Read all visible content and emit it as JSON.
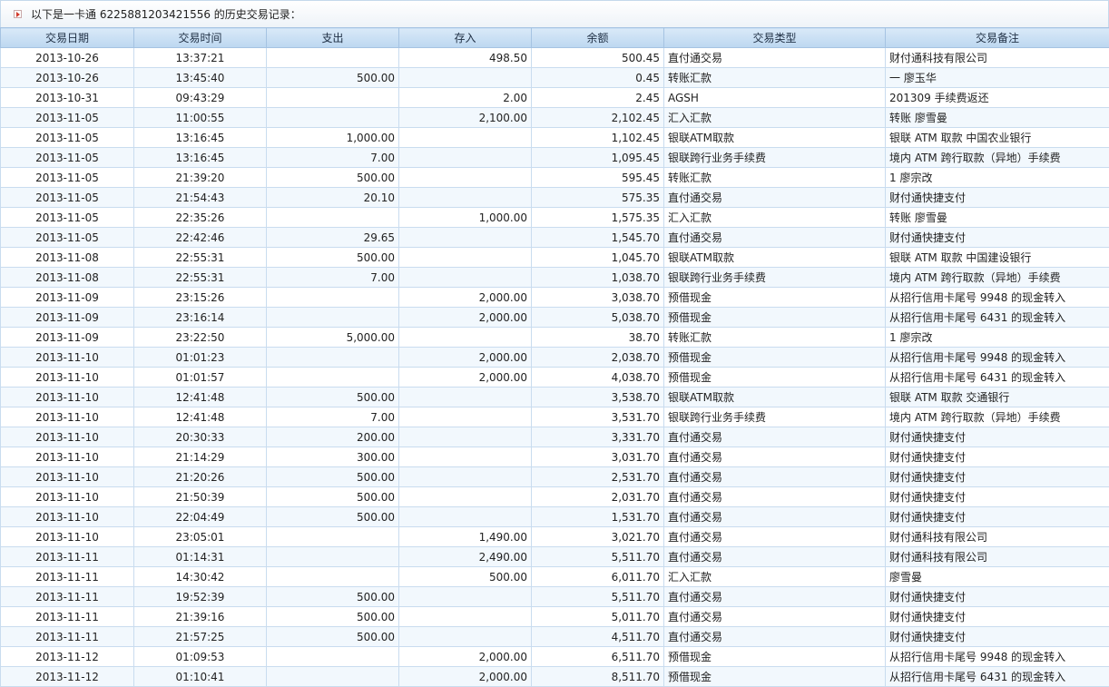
{
  "title": "以下是一卡通 6225881203421556 的历史交易记录：",
  "columns": [
    "交易日期",
    "交易时间",
    "支出",
    "存入",
    "余额",
    "交易类型",
    "交易备注"
  ],
  "rows": [
    [
      "2013-10-26",
      "13:37:21",
      "",
      "498.50",
      "500.45",
      "直付通交易",
      "财付通科技有限公司"
    ],
    [
      "2013-10-26",
      "13:45:40",
      "500.00",
      "",
      "0.45",
      "转账汇款",
      "一 廖玉华"
    ],
    [
      "2013-10-31",
      "09:43:29",
      "",
      "2.00",
      "2.45",
      "AGSH",
      "201309 手续费返还"
    ],
    [
      "2013-11-05",
      "11:00:55",
      "",
      "2,100.00",
      "2,102.45",
      "汇入汇款",
      "转账 廖雪曼"
    ],
    [
      "2013-11-05",
      "13:16:45",
      "1,000.00",
      "",
      "1,102.45",
      "银联ATM取款",
      "银联 ATM 取款 中国农业银行"
    ],
    [
      "2013-11-05",
      "13:16:45",
      "7.00",
      "",
      "1,095.45",
      "银联跨行业务手续费",
      "境内 ATM 跨行取款（异地）手续费"
    ],
    [
      "2013-11-05",
      "21:39:20",
      "500.00",
      "",
      "595.45",
      "转账汇款",
      "1 廖宗改"
    ],
    [
      "2013-11-05",
      "21:54:43",
      "20.10",
      "",
      "575.35",
      "直付通交易",
      "财付通快捷支付"
    ],
    [
      "2013-11-05",
      "22:35:26",
      "",
      "1,000.00",
      "1,575.35",
      "汇入汇款",
      "转账 廖雪曼"
    ],
    [
      "2013-11-05",
      "22:42:46",
      "29.65",
      "",
      "1,545.70",
      "直付通交易",
      "财付通快捷支付"
    ],
    [
      "2013-11-08",
      "22:55:31",
      "500.00",
      "",
      "1,045.70",
      "银联ATM取款",
      "银联 ATM 取款 中国建设银行"
    ],
    [
      "2013-11-08",
      "22:55:31",
      "7.00",
      "",
      "1,038.70",
      "银联跨行业务手续费",
      "境内 ATM 跨行取款（异地）手续费"
    ],
    [
      "2013-11-09",
      "23:15:26",
      "",
      "2,000.00",
      "3,038.70",
      "预借现金",
      "从招行信用卡尾号 9948 的现金转入"
    ],
    [
      "2013-11-09",
      "23:16:14",
      "",
      "2,000.00",
      "5,038.70",
      "预借现金",
      "从招行信用卡尾号 6431 的现金转入"
    ],
    [
      "2013-11-09",
      "23:22:50",
      "5,000.00",
      "",
      "38.70",
      "转账汇款",
      "1 廖宗改"
    ],
    [
      "2013-11-10",
      "01:01:23",
      "",
      "2,000.00",
      "2,038.70",
      "预借现金",
      "从招行信用卡尾号 9948 的现金转入"
    ],
    [
      "2013-11-10",
      "01:01:57",
      "",
      "2,000.00",
      "4,038.70",
      "预借现金",
      "从招行信用卡尾号 6431 的现金转入"
    ],
    [
      "2013-11-10",
      "12:41:48",
      "500.00",
      "",
      "3,538.70",
      "银联ATM取款",
      "银联 ATM 取款 交通银行"
    ],
    [
      "2013-11-10",
      "12:41:48",
      "7.00",
      "",
      "3,531.70",
      "银联跨行业务手续费",
      "境内 ATM 跨行取款（异地）手续费"
    ],
    [
      "2013-11-10",
      "20:30:33",
      "200.00",
      "",
      "3,331.70",
      "直付通交易",
      "财付通快捷支付"
    ],
    [
      "2013-11-10",
      "21:14:29",
      "300.00",
      "",
      "3,031.70",
      "直付通交易",
      "财付通快捷支付"
    ],
    [
      "2013-11-10",
      "21:20:26",
      "500.00",
      "",
      "2,531.70",
      "直付通交易",
      "财付通快捷支付"
    ],
    [
      "2013-11-10",
      "21:50:39",
      "500.00",
      "",
      "2,031.70",
      "直付通交易",
      "财付通快捷支付"
    ],
    [
      "2013-11-10",
      "22:04:49",
      "500.00",
      "",
      "1,531.70",
      "直付通交易",
      "财付通快捷支付"
    ],
    [
      "2013-11-10",
      "23:05:01",
      "",
      "1,490.00",
      "3,021.70",
      "直付通交易",
      "财付通科技有限公司"
    ],
    [
      "2013-11-11",
      "01:14:31",
      "",
      "2,490.00",
      "5,511.70",
      "直付通交易",
      "财付通科技有限公司"
    ],
    [
      "2013-11-11",
      "14:30:42",
      "",
      "500.00",
      "6,011.70",
      "汇入汇款",
      "廖雪曼"
    ],
    [
      "2013-11-11",
      "19:52:39",
      "500.00",
      "",
      "5,511.70",
      "直付通交易",
      "财付通快捷支付"
    ],
    [
      "2013-11-11",
      "21:39:16",
      "500.00",
      "",
      "5,011.70",
      "直付通交易",
      "财付通快捷支付"
    ],
    [
      "2013-11-11",
      "21:57:25",
      "500.00",
      "",
      "4,511.70",
      "直付通交易",
      "财付通快捷支付"
    ],
    [
      "2013-11-12",
      "01:09:53",
      "",
      "2,000.00",
      "6,511.70",
      "预借现金",
      "从招行信用卡尾号 9948 的现金转入"
    ],
    [
      "2013-11-12",
      "01:10:41",
      "",
      "2,000.00",
      "8,511.70",
      "预借现金",
      "从招行信用卡尾号 6431 的现金转入"
    ]
  ],
  "icons": {
    "title_marker": "arrow-marker-icon"
  }
}
